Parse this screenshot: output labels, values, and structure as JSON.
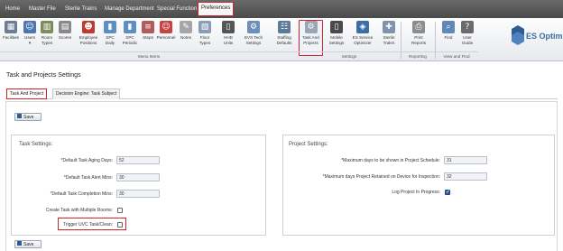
{
  "top_menu": {
    "tabs": [
      {
        "label": "Home"
      },
      {
        "label": "Master File"
      },
      {
        "label": "Sterile Trakrs"
      },
      {
        "label": "Manage Department"
      },
      {
        "label": "Special Function"
      },
      {
        "label": "Preferences"
      }
    ]
  },
  "ribbon": {
    "buttons": [
      {
        "label": "Facilities",
        "icon": "building-icon"
      },
      {
        "label": "Users\n▾",
        "icon": "users-icon"
      },
      {
        "label": "Room\nTypes",
        "icon": "room-icon"
      },
      {
        "label": "Scores",
        "icon": "scores-icon"
      },
      {
        "label": "Employee\nPositions",
        "icon": "employee-icon"
      },
      {
        "label": "SPC\nDaily",
        "icon": "chart-icon"
      },
      {
        "label": "SPC\nPeriodic",
        "icon": "chart-icon"
      },
      {
        "label": "Steps",
        "icon": "steps-icon"
      },
      {
        "label": "Personnel",
        "icon": "personnel-icon"
      },
      {
        "label": "Notes",
        "icon": "notes-icon"
      },
      {
        "label": "Floor\nTypes",
        "icon": "floor-icon"
      },
      {
        "label": "HHD\nUnits",
        "icon": "device-icon"
      },
      {
        "label": "EVS Tech\nSettings",
        "icon": "tech-icon"
      },
      {
        "label": "Staffing\nDefaults",
        "icon": "staffing-icon"
      },
      {
        "label": "Task And\nProjects",
        "icon": "gear-icon"
      },
      {
        "label": "Mobile\nSettings",
        "icon": "mobile-icon"
      },
      {
        "label": "ES Service\nOptimizer",
        "icon": "optimizer-icon"
      },
      {
        "label": "Sterile\nTrakrs",
        "icon": "sterile-icon"
      },
      {
        "label": "Print\nReports",
        "icon": "print-icon"
      },
      {
        "label": "Find",
        "icon": "find-icon"
      },
      {
        "label": "User\nGuide",
        "icon": "guide-icon"
      }
    ],
    "groups": {
      "menu_items": "Menu Items",
      "settings": "Settings",
      "reporting": "Reporting",
      "view_and_find": "View and Find"
    },
    "logo_text": "ES Optimiz"
  },
  "page": {
    "title": "Task and Projects Settings",
    "tabs": [
      {
        "label": "Task And Project"
      },
      {
        "label": "Decision Engine: Task Subject"
      }
    ],
    "save_label": "Save"
  },
  "task_settings": {
    "title": "Task Settings:",
    "aging_days_label": "*Default Task Aging Days:",
    "aging_days_value": "52",
    "alert_mins_label": "*Default Task Alert Mins:",
    "alert_mins_value": "30",
    "completion_mins_label": "*Default Task Completion Mins:",
    "completion_mins_value": "30",
    "multiple_rooms_label": "Create Task with Multiple Rooms:",
    "trigger_uvc_label": "Trigger UVC Task/Clean:"
  },
  "project_settings": {
    "title": "Project Settings:",
    "max_days_schedule_label": "*Maximum days to be shown in Project Schedule:",
    "max_days_schedule_value": "31",
    "max_days_retained_label": "*Maximum days Project Retained on Device for Inspection:",
    "max_days_retained_value": "32",
    "log_in_progress_label": "Log Project In Progress:"
  },
  "colors": {
    "highlight": "#d2232a",
    "menu_bar": "#555555",
    "checkbox_checked": "#2a5ca8"
  }
}
